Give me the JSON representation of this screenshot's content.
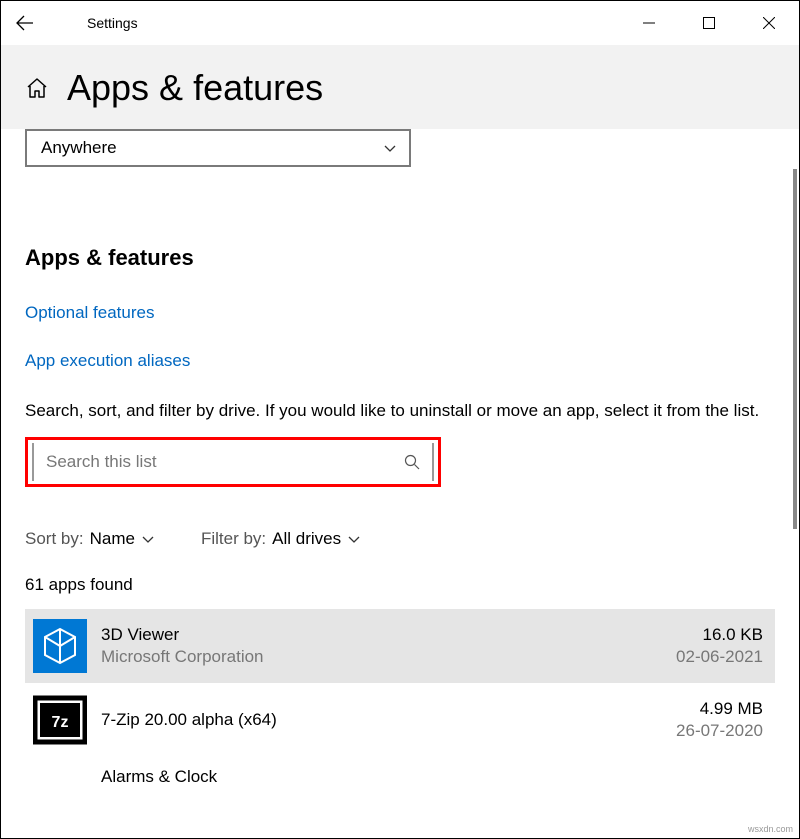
{
  "window": {
    "title": "Settings"
  },
  "header": {
    "page_title": "Apps & features"
  },
  "install_source": {
    "selected": "Anywhere"
  },
  "section": {
    "heading": "Apps & features",
    "links": {
      "optional_features": "Optional features",
      "app_execution_aliases": "App execution aliases"
    },
    "help_text": "Search, sort, and filter by drive. If you would like to uninstall or move an app, select it from the list."
  },
  "search": {
    "placeholder": "Search this list"
  },
  "sort": {
    "label": "Sort by:",
    "value": "Name"
  },
  "filter": {
    "label": "Filter by:",
    "value": "All drives"
  },
  "count_text": "61 apps found",
  "apps": [
    {
      "name": "3D Viewer",
      "publisher": "Microsoft Corporation",
      "size": "16.0 KB",
      "date": "02-06-2021"
    },
    {
      "name": "7-Zip 20.00 alpha (x64)",
      "publisher": "",
      "size": "4.99 MB",
      "date": "26-07-2020"
    },
    {
      "name": "Alarms & Clock",
      "publisher": "",
      "size": "",
      "date": ""
    }
  ],
  "watermark": "wsxdn.com"
}
